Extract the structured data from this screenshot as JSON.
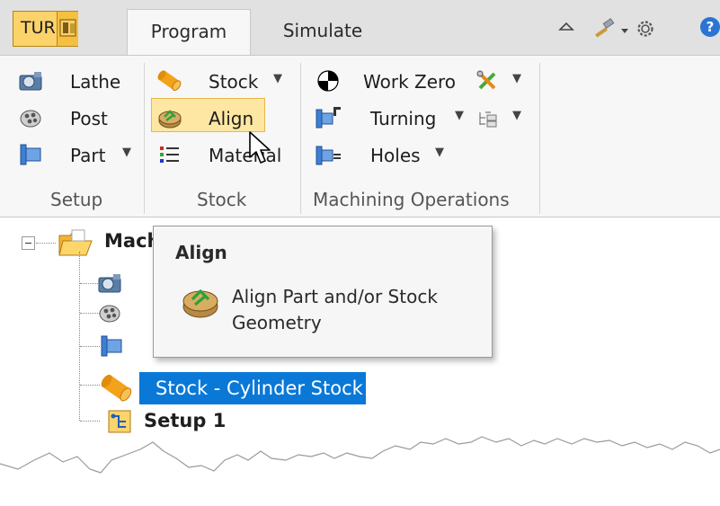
{
  "app": {
    "turn_label": "TURN",
    "tabs": [
      {
        "label": "Program",
        "active": true
      },
      {
        "label": "Simulate",
        "active": false
      }
    ],
    "quick_access": [
      "collapse-ribbon-icon",
      "hammer-icon",
      "settings-gear-icon",
      "help-icon"
    ]
  },
  "ribbon": {
    "setup": {
      "items": [
        {
          "label": "Lathe",
          "icon": "lathe-icon"
        },
        {
          "label": "Post",
          "icon": "post-icon"
        },
        {
          "label": "Part",
          "icon": "part-icon",
          "dropdown": true
        }
      ],
      "group_label": "Setup"
    },
    "stock": {
      "items": [
        {
          "label": "Stock",
          "icon": "stock-cylinder-icon",
          "dropdown": true
        },
        {
          "label": "Align",
          "icon": "align-icon",
          "hovered": true
        },
        {
          "label": "Material",
          "icon": "material-list-icon"
        }
      ],
      "group_label": "Stock"
    },
    "machining": {
      "items": [
        {
          "label": "Work Zero",
          "icon": "work-zero-icon",
          "extra_icon": "tools-icon"
        },
        {
          "label": "Turning",
          "icon": "turning-icon",
          "dropdown": true,
          "extra_icon": "tree-list-icon"
        },
        {
          "label": "Holes",
          "icon": "holes-icon",
          "dropdown": true
        }
      ],
      "group_label": "Machining Operations"
    }
  },
  "tree": {
    "root_label": "Mach",
    "selected_label": "Stock - Cylinder Stock",
    "setup_label": "Setup 1"
  },
  "tooltip": {
    "title": "Align",
    "description": "Align Part and/or Stock Geometry"
  },
  "colors": {
    "selection": "#0a78d7",
    "hover_fill": "#fde7a2",
    "turn_button": "#fcd26a",
    "tooltip_bg": "#f6f6f6"
  }
}
